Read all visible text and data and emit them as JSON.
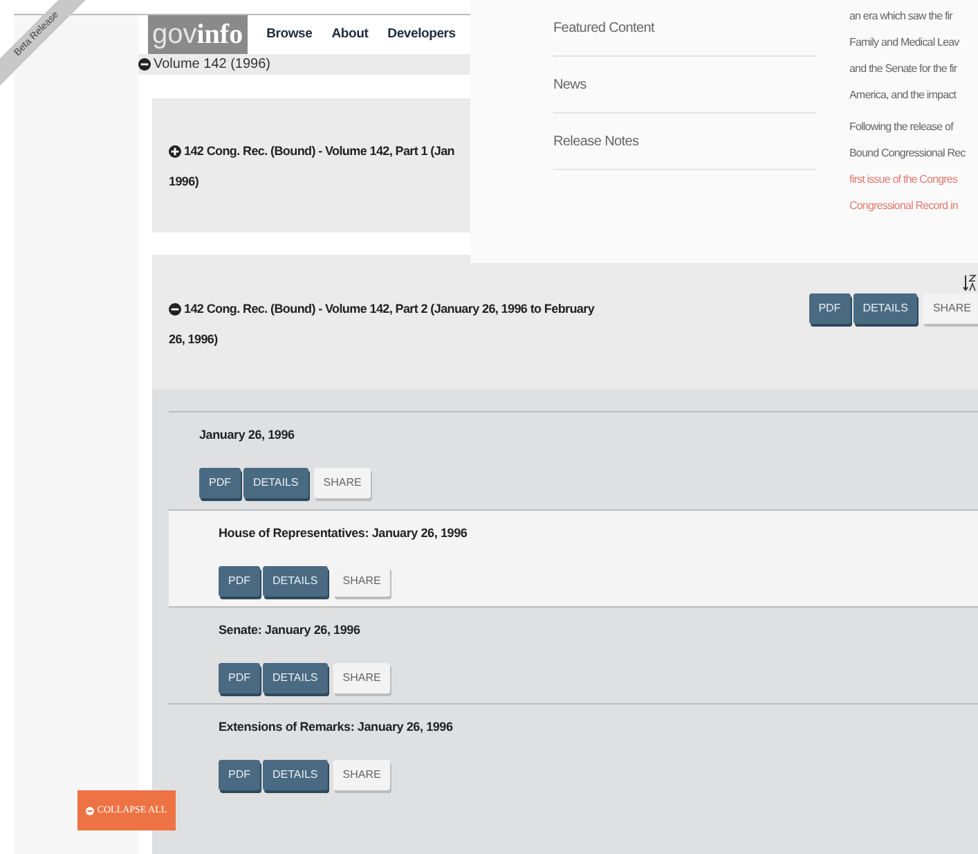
{
  "ribbon": {
    "label": "Beta Release"
  },
  "header": {
    "logo": {
      "prefix": "gov",
      "suffix": "info"
    },
    "nav": [
      "Browse",
      "About",
      "Developers"
    ]
  },
  "volume": {
    "label": "Volume 142 (1996)",
    "expanded": true
  },
  "parts": [
    {
      "title_lines": [
        "142 Cong. Rec. (Bound) - Volume 142, Part 1 (Jan",
        "1996)"
      ],
      "expanded": false
    },
    {
      "title_lines": [
        "142 Cong. Rec. (Bound) - Volume 142, Part 2 (January 26, 1996 to February",
        "26, 1996)"
      ],
      "expanded": true,
      "sort": true,
      "buttons": [
        {
          "label": "PDF",
          "kind": "primary"
        },
        {
          "label": "DETAILS",
          "kind": "primary"
        },
        {
          "label": "SHARE",
          "kind": "plain"
        }
      ],
      "groups": [
        {
          "title": "January 26, 1996",
          "buttons": [
            {
              "label": "PDF",
              "kind": "primary"
            },
            {
              "label": "DETAILS",
              "kind": "primary"
            },
            {
              "label": "SHARE",
              "kind": "plain"
            }
          ],
          "children": [
            {
              "title": "House of Representatives: January 26, 1996",
              "selected": true,
              "buttons": [
                {
                  "label": "PDF",
                  "kind": "primary"
                },
                {
                  "label": "DETAILS",
                  "kind": "primary"
                },
                {
                  "label": "SHARE",
                  "kind": "plain"
                }
              ]
            },
            {
              "title": "Senate: January 26, 1996",
              "selected": false,
              "buttons": [
                {
                  "label": "PDF",
                  "kind": "primary"
                },
                {
                  "label": "DETAILS",
                  "kind": "primary"
                },
                {
                  "label": "SHARE",
                  "kind": "plain"
                }
              ]
            },
            {
              "title": "Extensions of Remarks: January 26, 1996",
              "selected": false,
              "buttons": [
                {
                  "label": "PDF",
                  "kind": "primary"
                },
                {
                  "label": "DETAILS",
                  "kind": "primary"
                },
                {
                  "label": "SHARE",
                  "kind": "plain"
                }
              ]
            }
          ]
        }
      ]
    }
  ],
  "dropdown": {
    "menu": [
      "Featured Content",
      "News",
      "Release Notes"
    ],
    "paragraphs": [
      {
        "lines": [
          {
            "text": "an era which saw the fir",
            "kind": "text"
          },
          {
            "text": "Family and Medical Leav",
            "kind": "text"
          },
          {
            "text": "and the Senate for the fir",
            "kind": "text"
          },
          {
            "text": "America, and the impact",
            "kind": "text"
          }
        ]
      },
      {
        "lines": [
          {
            "text": "Following the release of",
            "kind": "text"
          },
          {
            "text": "Bound Congressional Rec",
            "kind": "text"
          },
          {
            "text": "first issue of the Congres",
            "kind": "link"
          },
          {
            "text": "Congressional Record in",
            "kind": "link"
          }
        ]
      }
    ]
  },
  "collapse_all": {
    "label": "COLLAPSE ALL"
  }
}
